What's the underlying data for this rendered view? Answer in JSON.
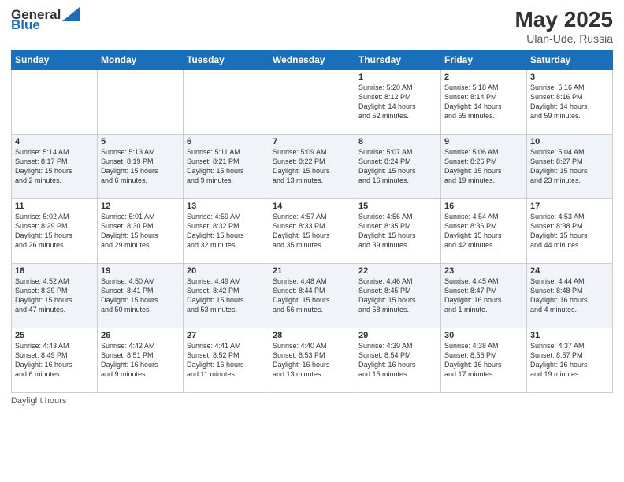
{
  "header": {
    "logo_general": "General",
    "logo_blue": "Blue",
    "main_title": "May 2025",
    "subtitle": "Ulan-Ude, Russia"
  },
  "days_of_week": [
    "Sunday",
    "Monday",
    "Tuesday",
    "Wednesday",
    "Thursday",
    "Friday",
    "Saturday"
  ],
  "footer_label": "Daylight hours",
  "weeks": [
    [
      {
        "day": "",
        "info": ""
      },
      {
        "day": "",
        "info": ""
      },
      {
        "day": "",
        "info": ""
      },
      {
        "day": "",
        "info": ""
      },
      {
        "day": "1",
        "info": "Sunrise: 5:20 AM\nSunset: 8:12 PM\nDaylight: 14 hours\nand 52 minutes."
      },
      {
        "day": "2",
        "info": "Sunrise: 5:18 AM\nSunset: 8:14 PM\nDaylight: 14 hours\nand 55 minutes."
      },
      {
        "day": "3",
        "info": "Sunrise: 5:16 AM\nSunset: 8:16 PM\nDaylight: 14 hours\nand 59 minutes."
      }
    ],
    [
      {
        "day": "4",
        "info": "Sunrise: 5:14 AM\nSunset: 8:17 PM\nDaylight: 15 hours\nand 2 minutes."
      },
      {
        "day": "5",
        "info": "Sunrise: 5:13 AM\nSunset: 8:19 PM\nDaylight: 15 hours\nand 6 minutes."
      },
      {
        "day": "6",
        "info": "Sunrise: 5:11 AM\nSunset: 8:21 PM\nDaylight: 15 hours\nand 9 minutes."
      },
      {
        "day": "7",
        "info": "Sunrise: 5:09 AM\nSunset: 8:22 PM\nDaylight: 15 hours\nand 13 minutes."
      },
      {
        "day": "8",
        "info": "Sunrise: 5:07 AM\nSunset: 8:24 PM\nDaylight: 15 hours\nand 16 minutes."
      },
      {
        "day": "9",
        "info": "Sunrise: 5:06 AM\nSunset: 8:26 PM\nDaylight: 15 hours\nand 19 minutes."
      },
      {
        "day": "10",
        "info": "Sunrise: 5:04 AM\nSunset: 8:27 PM\nDaylight: 15 hours\nand 23 minutes."
      }
    ],
    [
      {
        "day": "11",
        "info": "Sunrise: 5:02 AM\nSunset: 8:29 PM\nDaylight: 15 hours\nand 26 minutes."
      },
      {
        "day": "12",
        "info": "Sunrise: 5:01 AM\nSunset: 8:30 PM\nDaylight: 15 hours\nand 29 minutes."
      },
      {
        "day": "13",
        "info": "Sunrise: 4:59 AM\nSunset: 8:32 PM\nDaylight: 15 hours\nand 32 minutes."
      },
      {
        "day": "14",
        "info": "Sunrise: 4:57 AM\nSunset: 8:33 PM\nDaylight: 15 hours\nand 35 minutes."
      },
      {
        "day": "15",
        "info": "Sunrise: 4:56 AM\nSunset: 8:35 PM\nDaylight: 15 hours\nand 39 minutes."
      },
      {
        "day": "16",
        "info": "Sunrise: 4:54 AM\nSunset: 8:36 PM\nDaylight: 15 hours\nand 42 minutes."
      },
      {
        "day": "17",
        "info": "Sunrise: 4:53 AM\nSunset: 8:38 PM\nDaylight: 15 hours\nand 44 minutes."
      }
    ],
    [
      {
        "day": "18",
        "info": "Sunrise: 4:52 AM\nSunset: 8:39 PM\nDaylight: 15 hours\nand 47 minutes."
      },
      {
        "day": "19",
        "info": "Sunrise: 4:50 AM\nSunset: 8:41 PM\nDaylight: 15 hours\nand 50 minutes."
      },
      {
        "day": "20",
        "info": "Sunrise: 4:49 AM\nSunset: 8:42 PM\nDaylight: 15 hours\nand 53 minutes."
      },
      {
        "day": "21",
        "info": "Sunrise: 4:48 AM\nSunset: 8:44 PM\nDaylight: 15 hours\nand 56 minutes."
      },
      {
        "day": "22",
        "info": "Sunrise: 4:46 AM\nSunset: 8:45 PM\nDaylight: 15 hours\nand 58 minutes."
      },
      {
        "day": "23",
        "info": "Sunrise: 4:45 AM\nSunset: 8:47 PM\nDaylight: 16 hours\nand 1 minute."
      },
      {
        "day": "24",
        "info": "Sunrise: 4:44 AM\nSunset: 8:48 PM\nDaylight: 16 hours\nand 4 minutes."
      }
    ],
    [
      {
        "day": "25",
        "info": "Sunrise: 4:43 AM\nSunset: 8:49 PM\nDaylight: 16 hours\nand 6 minutes."
      },
      {
        "day": "26",
        "info": "Sunrise: 4:42 AM\nSunset: 8:51 PM\nDaylight: 16 hours\nand 9 minutes."
      },
      {
        "day": "27",
        "info": "Sunrise: 4:41 AM\nSunset: 8:52 PM\nDaylight: 16 hours\nand 11 minutes."
      },
      {
        "day": "28",
        "info": "Sunrise: 4:40 AM\nSunset: 8:53 PM\nDaylight: 16 hours\nand 13 minutes."
      },
      {
        "day": "29",
        "info": "Sunrise: 4:39 AM\nSunset: 8:54 PM\nDaylight: 16 hours\nand 15 minutes."
      },
      {
        "day": "30",
        "info": "Sunrise: 4:38 AM\nSunset: 8:56 PM\nDaylight: 16 hours\nand 17 minutes."
      },
      {
        "day": "31",
        "info": "Sunrise: 4:37 AM\nSunset: 8:57 PM\nDaylight: 16 hours\nand 19 minutes."
      }
    ]
  ]
}
